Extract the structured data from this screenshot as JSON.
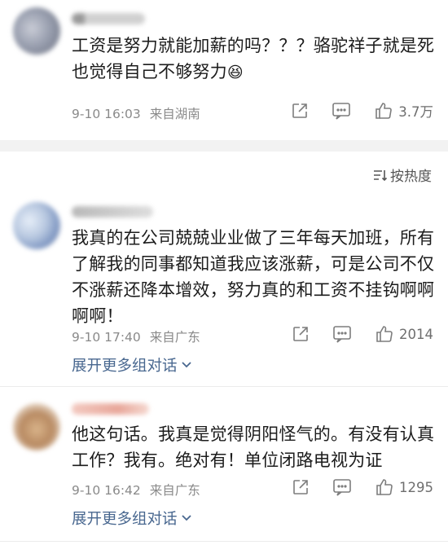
{
  "comments": [
    {
      "username": "W",
      "text": "工资是努力就能加薪的吗？？？骆驼祥子就是死也觉得自己不够努力",
      "emoji": "😆",
      "date": "9-10 16:03",
      "source": "来自湖南",
      "likes": "3.7万"
    },
    {
      "username": "",
      "text": "我真的在公司兢兢业业做了三年每天加班，所有了解我的同事都知道我应该涨薪，可是公司不仅不涨薪还降本增效，努力真的和工资不挂钩啊啊啊啊！",
      "date": "9-10 17:40",
      "source": "来自广东",
      "likes": "2014",
      "expand_label": "展开更多组对话"
    },
    {
      "username": "",
      "text": "他这句话。我真是觉得阴阳怪气的。有没有认真工作？我有。绝对有！单位闭路电视为证",
      "date": "9-10 16:42",
      "source": "来自广东",
      "likes": "1295",
      "expand_label": "展开更多组对话"
    }
  ],
  "sort": {
    "label": "按热度"
  },
  "colors": {
    "link": "#48678f",
    "meta": "#8a8a8a",
    "band": "#f2f2f2"
  }
}
